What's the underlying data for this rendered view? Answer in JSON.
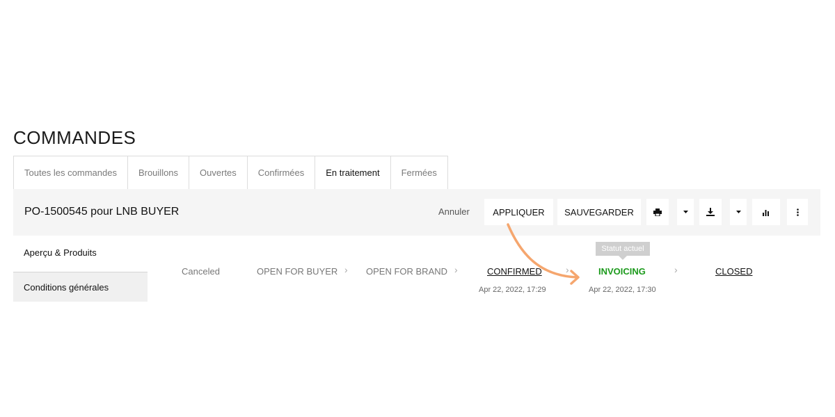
{
  "page": {
    "title": "COMMANDES"
  },
  "tabs": [
    {
      "label": "Toutes les commandes"
    },
    {
      "label": "Brouillons"
    },
    {
      "label": "Ouvertes"
    },
    {
      "label": "Confirmées"
    },
    {
      "label": "En traitement"
    },
    {
      "label": "Fermées"
    }
  ],
  "active_tab": "En traitement",
  "order": {
    "title": "PO-1500545 pour LNB BUYER",
    "cancel_label": "Annuler",
    "apply_label": "APPLIQUER",
    "save_label": "SAUVEGARDER"
  },
  "toolbar_icons": [
    "print-icon",
    "caret-down-icon",
    "download-icon",
    "caret-down-icon",
    "bar-chart-icon",
    "more-vertical-icon"
  ],
  "sidebar": {
    "items": [
      {
        "label": "Aperçu & Produits"
      },
      {
        "label": "Conditions générales"
      }
    ]
  },
  "status": {
    "tooltip": "Statut actuel",
    "steps": [
      {
        "label": "Canceled",
        "state": "inactive",
        "date": ""
      },
      {
        "label": "OPEN FOR BUYER",
        "state": "inactive",
        "date": ""
      },
      {
        "label": "OPEN FOR BRAND",
        "state": "inactive",
        "date": ""
      },
      {
        "label": "CONFIRMED",
        "state": "done",
        "date": "Apr 22, 2022, 17:29"
      },
      {
        "label": "INVOICING",
        "state": "current",
        "date": "Apr 22, 2022, 17:30"
      },
      {
        "label": "CLOSED",
        "state": "done",
        "date": ""
      }
    ]
  },
  "colors": {
    "current_status": "#1c9a1c",
    "annotation_arrow": "#f5a66e",
    "header_bg": "#f5f5f5"
  }
}
